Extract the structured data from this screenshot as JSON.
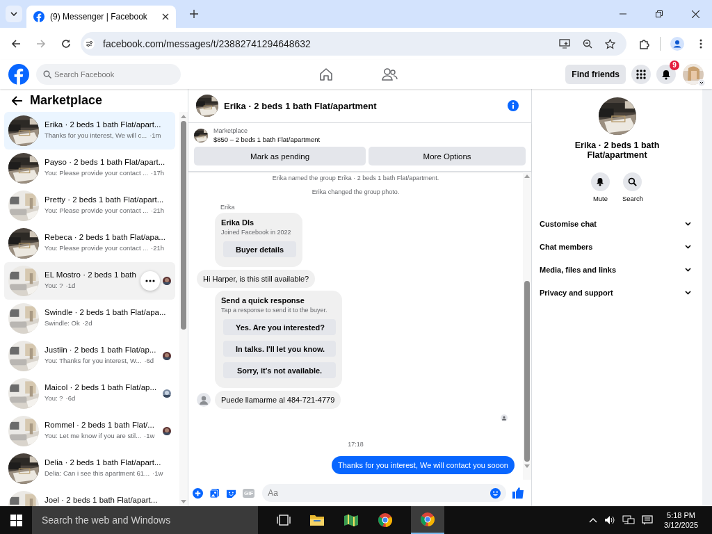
{
  "browser": {
    "tab_title": "(9) Messenger | Facebook",
    "url": "facebook.com/messages/t/23882741294648632"
  },
  "header": {
    "search_placeholder": "Search Facebook",
    "find_friends": "Find friends",
    "notification_count": "9"
  },
  "sidebar": {
    "title": "Marketplace",
    "conversations": [
      {
        "name": "Erika · 2 beds 1 bath Flat/apart...",
        "preview": "Thanks for you interest, We will c...",
        "time": "·1m",
        "selected": true,
        "hovered": false,
        "seen_avatar": false
      },
      {
        "name": "Payso · 2 beds 1 bath Flat/apart...",
        "preview": "You: Please provide your contact ...",
        "time": "·17h",
        "selected": false,
        "hovered": false,
        "seen_avatar": false
      },
      {
        "name": "Pretty · 2 beds 1 bath Flat/apart...",
        "preview": "You: Please provide your contact ...",
        "time": "·21h",
        "selected": false,
        "hovered": false,
        "seen_avatar": false
      },
      {
        "name": "Rebeca · 2 beds 1 bath Flat/apa...",
        "preview": "You: Please provide your contact ...",
        "time": "·21h",
        "selected": false,
        "hovered": false,
        "seen_avatar": false
      },
      {
        "name": "EL Mostro · 2 beds 1 bath",
        "preview": "You: ?",
        "time": "·1d",
        "selected": false,
        "hovered": true,
        "seen_avatar": true
      },
      {
        "name": "Swindle · 2 beds 1 bath Flat/apa...",
        "preview": "Swindle: Ok",
        "time": "·2d",
        "selected": false,
        "hovered": false,
        "seen_avatar": false
      },
      {
        "name": "Justiin · 2 beds 1 bath Flat/ap...",
        "preview": "You: Thanks for you interest, W...",
        "time": "·6d",
        "selected": false,
        "hovered": false,
        "seen_avatar": true
      },
      {
        "name": "Maicol · 2 beds 1 bath Flat/ap...",
        "preview": "You: ?",
        "time": "·6d",
        "selected": false,
        "hovered": false,
        "seen_avatar": true
      },
      {
        "name": "Rommel · 2 beds 1 bath Flat/...",
        "preview": "You: Let me know if you are stil...",
        "time": "·1w",
        "selected": false,
        "hovered": false,
        "seen_avatar": true
      },
      {
        "name": "Delia · 2 beds 1 bath Flat/apart...",
        "preview": "Delia: Can i see this apartment 61...",
        "time": "·1w",
        "selected": false,
        "hovered": false,
        "seen_avatar": false
      },
      {
        "name": "Joel · 2 beds 1 bath Flat/apart...",
        "selected": false,
        "hovered": false,
        "seen_avatar": false
      }
    ]
  },
  "chat": {
    "title": "Erika · 2 beds 1 bath Flat/apartment",
    "listing": {
      "label": "Marketplace",
      "price_title": "$850 – 2 beds 1 bath Flat/apartment",
      "buttons": [
        "Mark as pending",
        "More Options"
      ]
    },
    "messages": [
      {
        "kind": "system",
        "text": "Erika named the group Erika · 2 beds 1 bath Flat/apartment."
      },
      {
        "kind": "system",
        "text": "Erika changed the group photo."
      },
      {
        "kind": "sender",
        "text": "Erika"
      },
      {
        "kind": "buyer_card",
        "name": "Erika Dls",
        "subtitle": "Joined Facebook in 2022",
        "button": "Buyer details"
      },
      {
        "kind": "incoming",
        "text": "Hi Harper, is this still available?",
        "avatar": false
      },
      {
        "kind": "quick_response",
        "title": "Send a quick response",
        "subtitle": "Tap a response to send it to the buyer.",
        "options": [
          "Yes. Are you interested?",
          "In talks. I'll let you know.",
          "Sorry, it's not available."
        ]
      },
      {
        "kind": "incoming",
        "text": "Puede llamarme al 484-721-4779",
        "avatar": true
      },
      {
        "kind": "read_receipt"
      },
      {
        "kind": "timestamp",
        "text": "17:18"
      },
      {
        "kind": "outgoing",
        "text": "Thanks for you interest, We will contact you  sooon"
      }
    ],
    "composer": {
      "placeholder": "Aa",
      "gif_label": "GIF"
    }
  },
  "details": {
    "title": "Erika · 2 beds 1 bath Flat/apartment",
    "actions": [
      {
        "kind": "mute",
        "label": "Mute"
      },
      {
        "kind": "search",
        "label": "Search"
      }
    ],
    "sections": [
      "Customise chat",
      "Chat members",
      "Media, files and links",
      "Privacy and support"
    ]
  },
  "taskbar": {
    "search_placeholder": "Search the web and Windows",
    "time": "5:18 PM",
    "date": "3/12/2025"
  }
}
